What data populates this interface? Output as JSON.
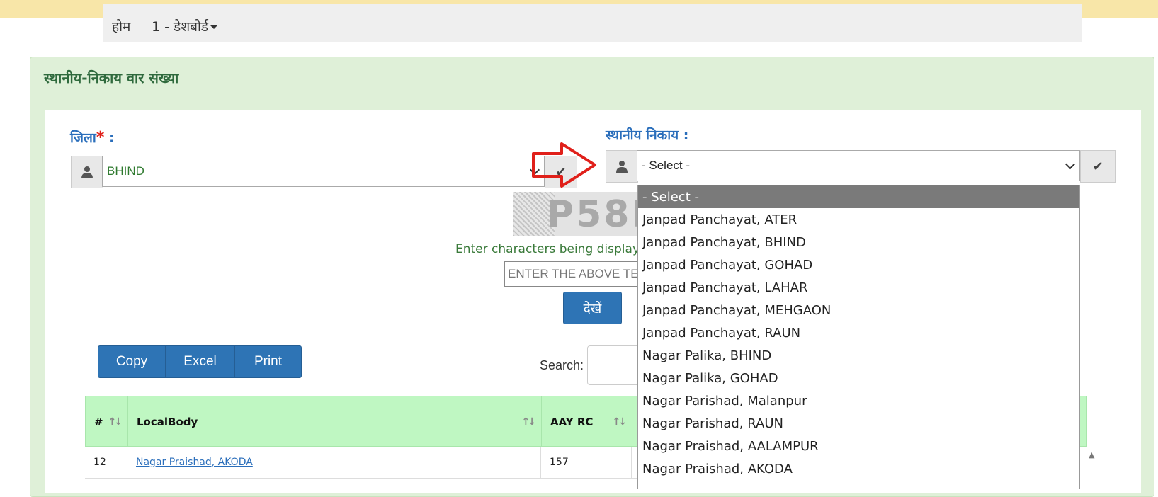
{
  "nav": {
    "home": "होम",
    "dashboard": "1 - डेशबोर्ड"
  },
  "panel": {
    "title": "स्थानीय-निकाय वार संख्या"
  },
  "district": {
    "label": "जिला",
    "required_mark": "*",
    "colon": " :",
    "value": "BHIND"
  },
  "local_body": {
    "label": "स्थानीय निकाय :",
    "value": "- Select -"
  },
  "captcha": {
    "image_text": "P58R",
    "hint": "Enter characters being displayed",
    "placeholder": "ENTER THE ABOVE TEXT",
    "submit": "देखें"
  },
  "datatable": {
    "buttons": [
      "Copy",
      "Excel",
      "Print"
    ],
    "search_label": "Search:",
    "columns": [
      "#",
      "LocalBody",
      "AAY RC"
    ],
    "rows": [
      {
        "num": "12",
        "local_body": "Nagar Praishad, AKODA",
        "aay_rc": "157"
      }
    ]
  },
  "dropdown_options": [
    "- Select -",
    "Janpad Panchayat, ATER",
    "Janpad Panchayat, BHIND",
    "Janpad Panchayat, GOHAD",
    "Janpad Panchayat, LAHAR",
    "Janpad Panchayat, MEHGAON",
    "Janpad Panchayat, RAUN",
    "Nagar Palika, BHIND",
    "Nagar Palika, GOHAD",
    "Nagar Parishad, Malanpur",
    "Nagar Parishad, RAUN",
    "Nagar Praishad, AALAMPUR",
    "Nagar Praishad, AKODA"
  ],
  "colors": {
    "primary": "#2e74b5",
    "panel_bg": "#dff0d8",
    "table_header": "#bff7c2",
    "label_blue": "#2a6ebb",
    "annotation_red": "#e0201a"
  }
}
